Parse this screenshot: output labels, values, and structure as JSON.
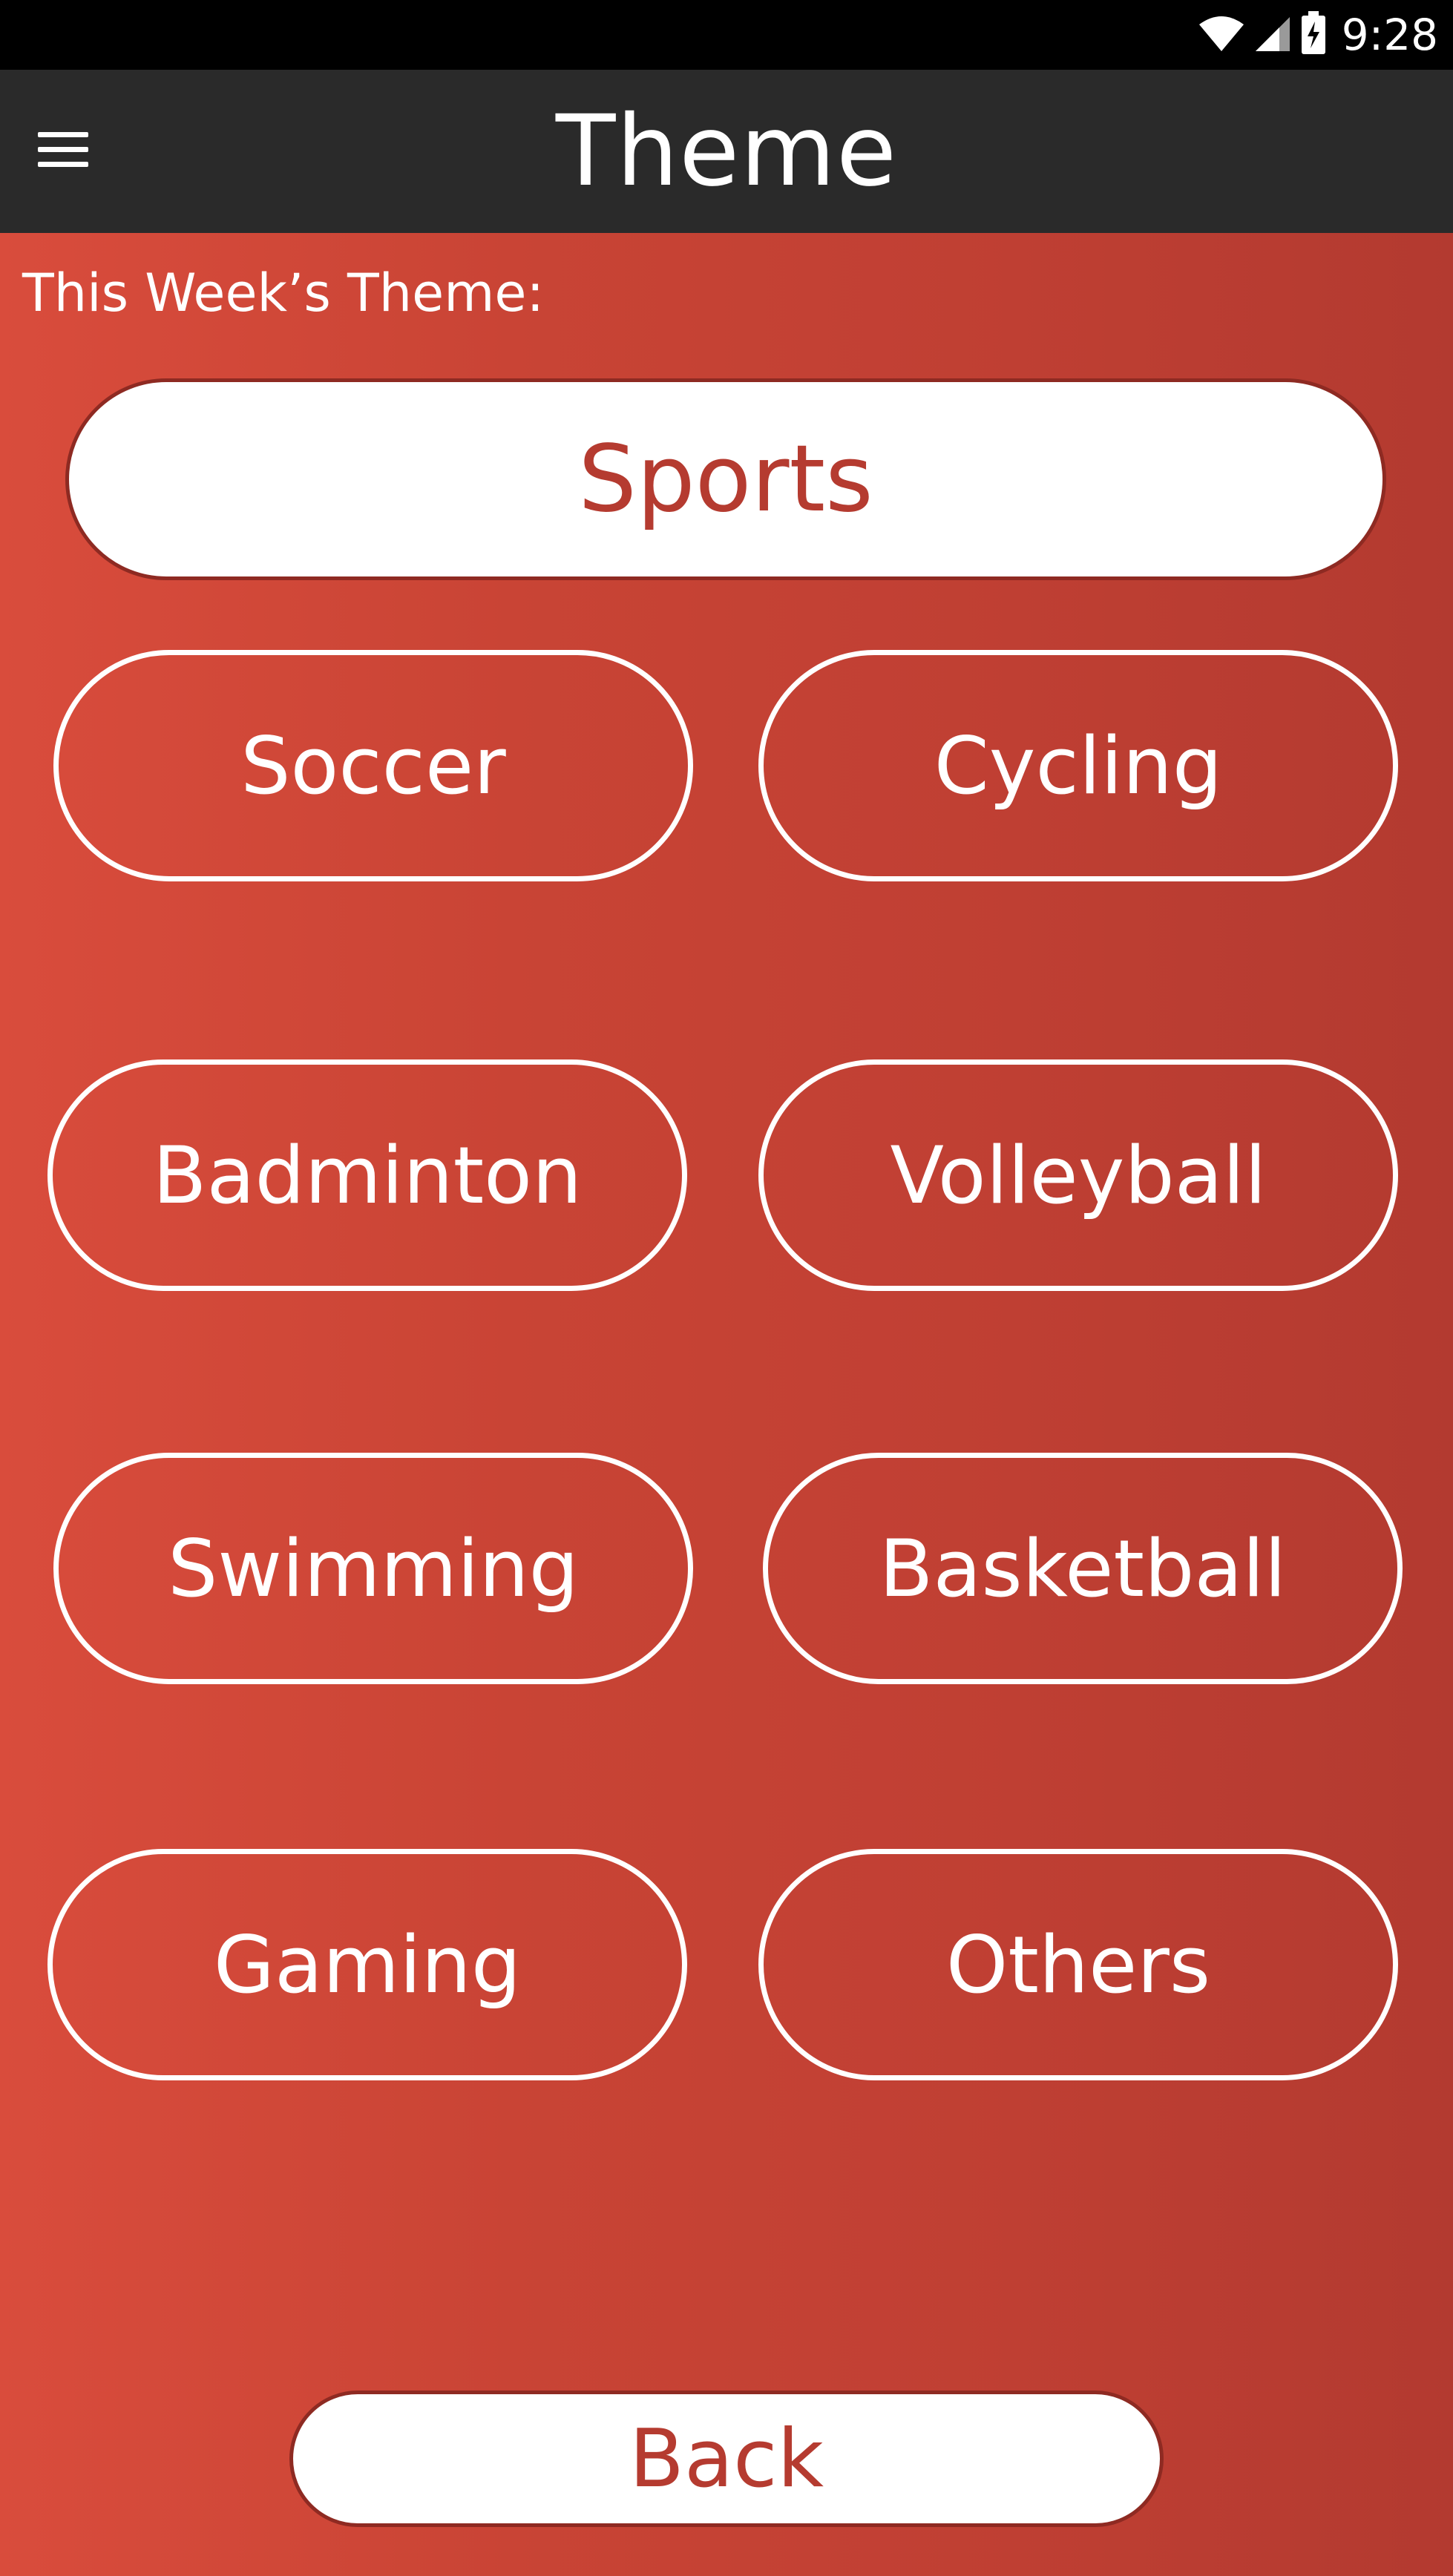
{
  "status_bar": {
    "time": "9:28",
    "icons": [
      "wifi-icon",
      "signal-icon",
      "battery-charging-icon"
    ]
  },
  "app_bar": {
    "title": "Theme",
    "menu_icon": "hamburger-menu-icon"
  },
  "main": {
    "week_label": "This Week’s Theme:",
    "current_theme": "Sports",
    "options": [
      {
        "label": "Soccer"
      },
      {
        "label": "Cycling"
      },
      {
        "label": "Badminton"
      },
      {
        "label": "Volleyball"
      },
      {
        "label": "Swimming"
      },
      {
        "label": "Basketball"
      },
      {
        "label": "Gaming"
      },
      {
        "label": "Others"
      }
    ],
    "back_label": "Back"
  },
  "colors": {
    "status_bar_bg": "#000000",
    "app_bar_bg": "#2a2a2a",
    "content_gradient_start": "#d94c3c",
    "content_gradient_end": "#b33a30",
    "accent_text": "#b53b30",
    "button_outline": "#ffffff"
  }
}
